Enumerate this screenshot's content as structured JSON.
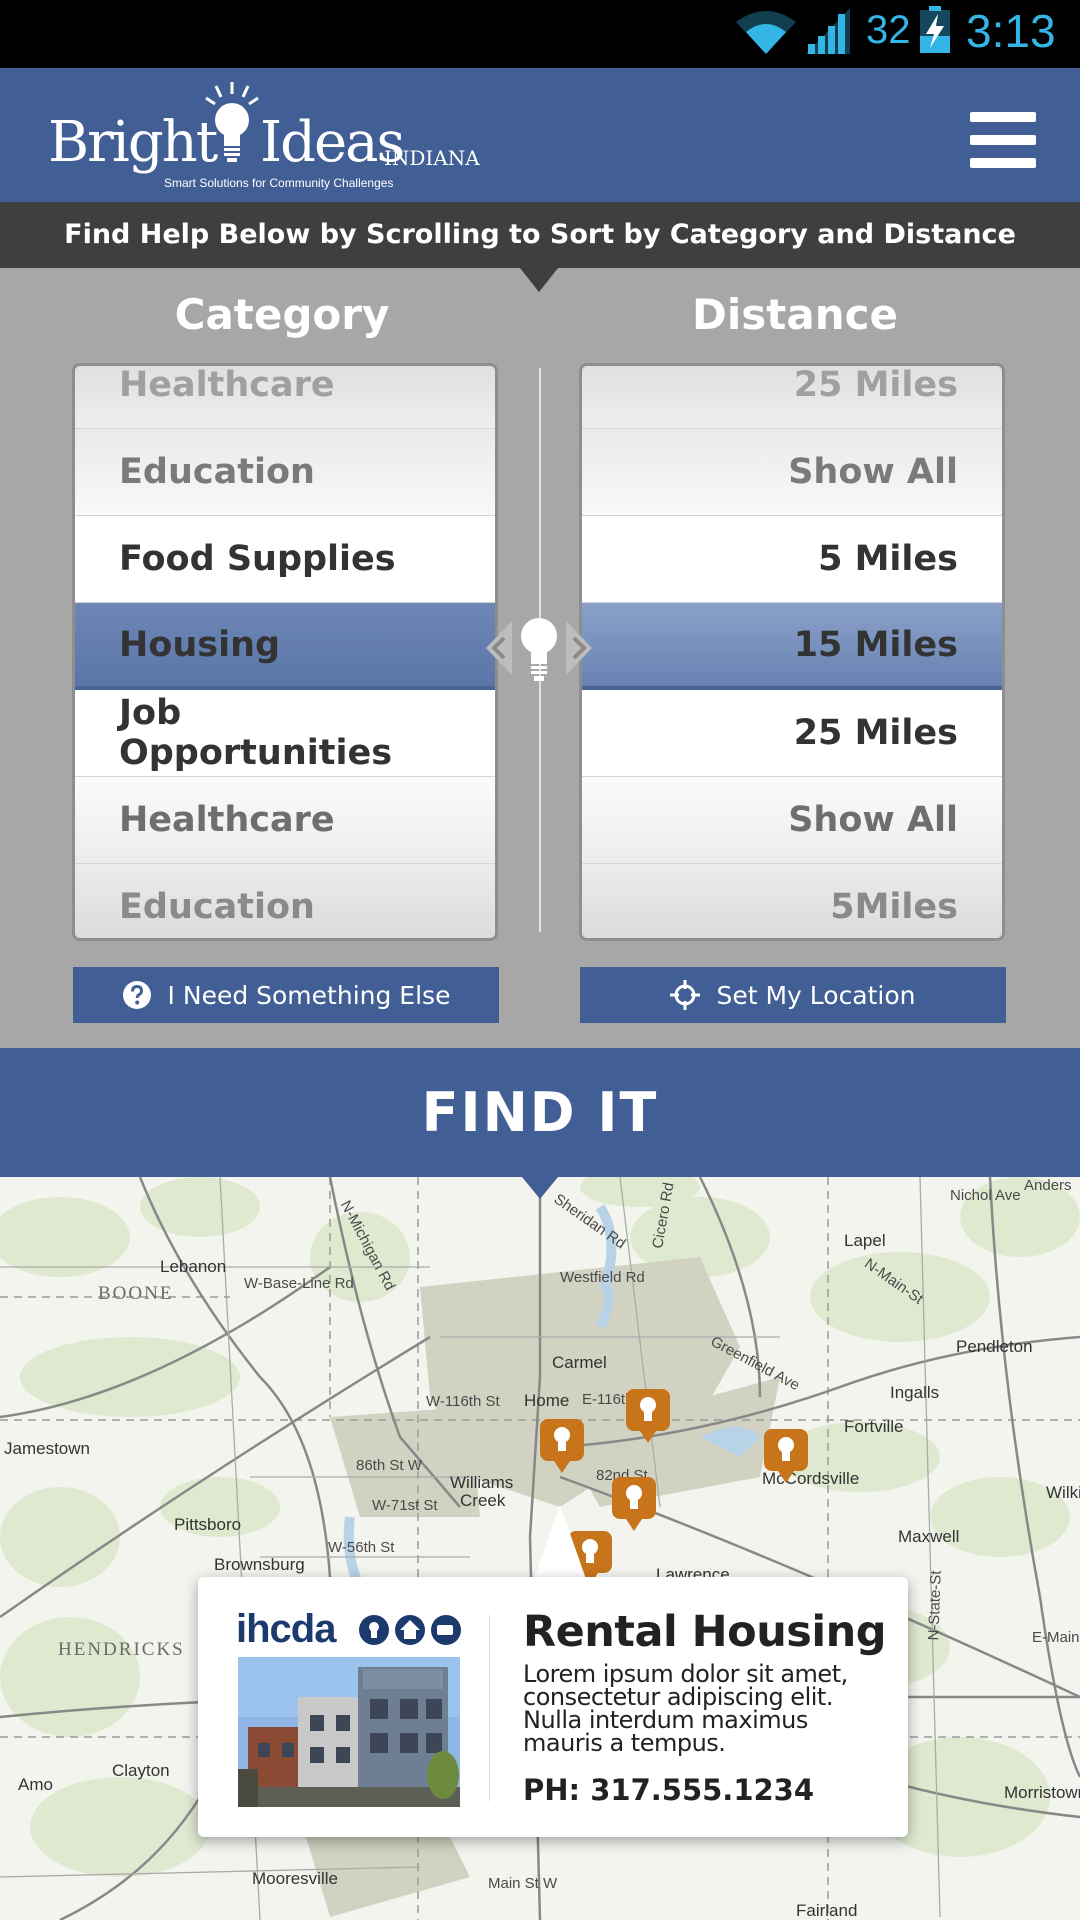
{
  "status_bar": {
    "battery_level": "32",
    "time": "3:13",
    "icons": [
      "wifi-icon",
      "signal-icon",
      "battery-charging-icon"
    ]
  },
  "header": {
    "logo_word_1": "Bright",
    "logo_word_2": "Ideas",
    "logo_state": "INDIANA",
    "logo_tagline": "Smart Solutions for Community Challenges",
    "menu_icon": "hamburger-menu-icon"
  },
  "instruction": "Find Help Below by Scrolling to Sort by Category and Distance",
  "category": {
    "title": "Category",
    "items": [
      "Healthcare",
      "Education",
      "Food Supplies",
      "Housing",
      "Job Opportunities",
      "Healthcare",
      "Education"
    ],
    "selected": "Housing"
  },
  "distance": {
    "title": "Distance",
    "items": [
      "25 Miles",
      "Show All",
      "5 Miles",
      "15 Miles",
      "25 Miles",
      "Show All",
      "5Miles"
    ],
    "selected": "15 Miles"
  },
  "buttons": {
    "need_else": "I Need Something Else",
    "set_location": "Set My Location"
  },
  "find_it": "FIND IT",
  "map": {
    "labels": {
      "nichol_ave": "Nichol Ave",
      "anders": "Anders",
      "lebanon": "Lebanon",
      "boone": "BOONE",
      "w_base_line": "W-Base-Line Rd",
      "sheridan": "Sheridan Rd",
      "westfield": "Westfield Rd",
      "lapel": "Lapel",
      "n_main": "N-Main-St",
      "greenfield": "Greenfield Ave",
      "pendleton": "Pendleton",
      "carmel": "Carmel",
      "ingalls": "Ingalls",
      "w116": "W-116th St",
      "home_place": "Home",
      "e116": "E-116th",
      "fortville": "Fortville",
      "jamestown": "Jamestown",
      "w86": "86th St W",
      "williams_creek": "Williams",
      "creek": "Creek",
      "w71": "W-71st St",
      "e82": "82nd St",
      "mccordsville": "McCordsville",
      "pittsboro": "Pittsboro",
      "w56": "W-56th St",
      "maxwell": "Maxwell",
      "brownsburg": "Brownsburg",
      "lawrence": "Lawrence",
      "hendricks": "HENDRICKS",
      "clayton": "Clayton",
      "amo": "Amo",
      "mooresville": "Mooresville",
      "fairland": "Fairland",
      "morristown": "Morristown",
      "main_st_w": "Main St W",
      "wilkin": "Wilki",
      "e_main": "E-Main",
      "n_state": "N-State-St",
      "cicero": "Cicero Rd",
      "michigan": "N-Michigan Rd"
    },
    "pin_icon": "lightbulb-pin-icon"
  },
  "popup": {
    "org_name": "ihcda",
    "title": "Rental Housing",
    "description": "Lorem ipsum dolor sit amet, consectetur adipiscing elit. Nulla interdum maximus mauris a tempus.",
    "phone": "PH: 317.555.1234"
  },
  "colors": {
    "brand_blue": "#425f95",
    "pin_orange": "#c7741a",
    "dark_bar": "#3f3f3f",
    "panel_gray": "#a7a7a7"
  }
}
